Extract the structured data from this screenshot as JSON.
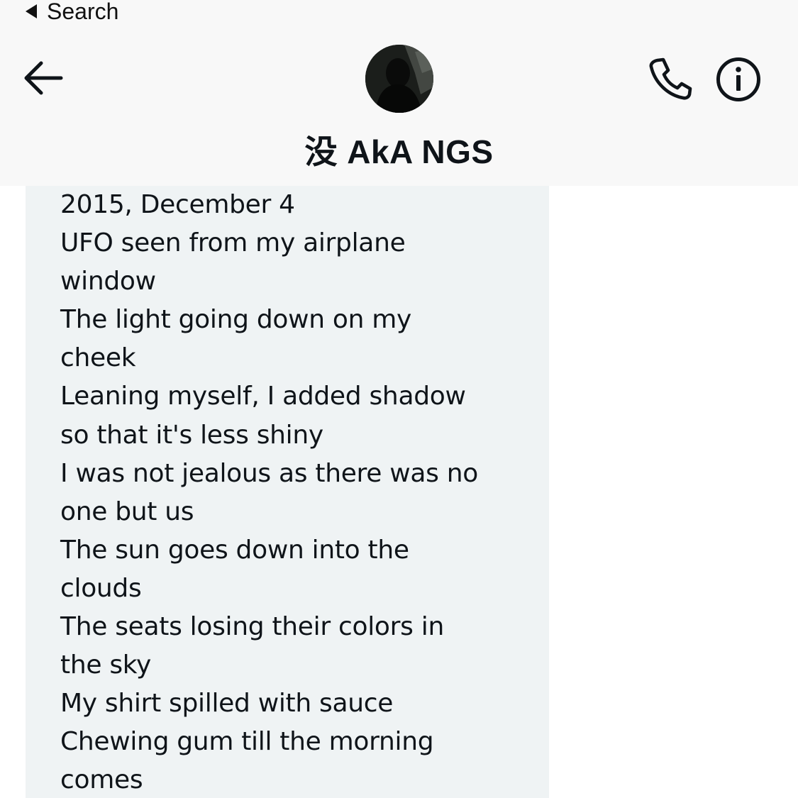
{
  "status_bar": {
    "back_label": "Search"
  },
  "header": {
    "contact_name": "没 AkA NGS",
    "icons": {
      "back": "back-arrow-icon",
      "phone": "phone-icon",
      "info": "info-icon"
    }
  },
  "message": {
    "text": "2015, December 4\nUFO seen from my airplane\nwindow\nThe light going down on my\ncheek\nLeaning myself, I added shadow\nso that it's less shiny\nI was not jealous as there was no\none but us\nThe sun goes down into the\nclouds\nThe seats losing their colors in\nthe sky\nMy shirt spilled with sauce\nChewing gum till the morning\ncomes"
  },
  "colors": {
    "header_bg": "#f8f8f8",
    "bubble_bg": "#eff3f4",
    "text": "#0f1419"
  }
}
